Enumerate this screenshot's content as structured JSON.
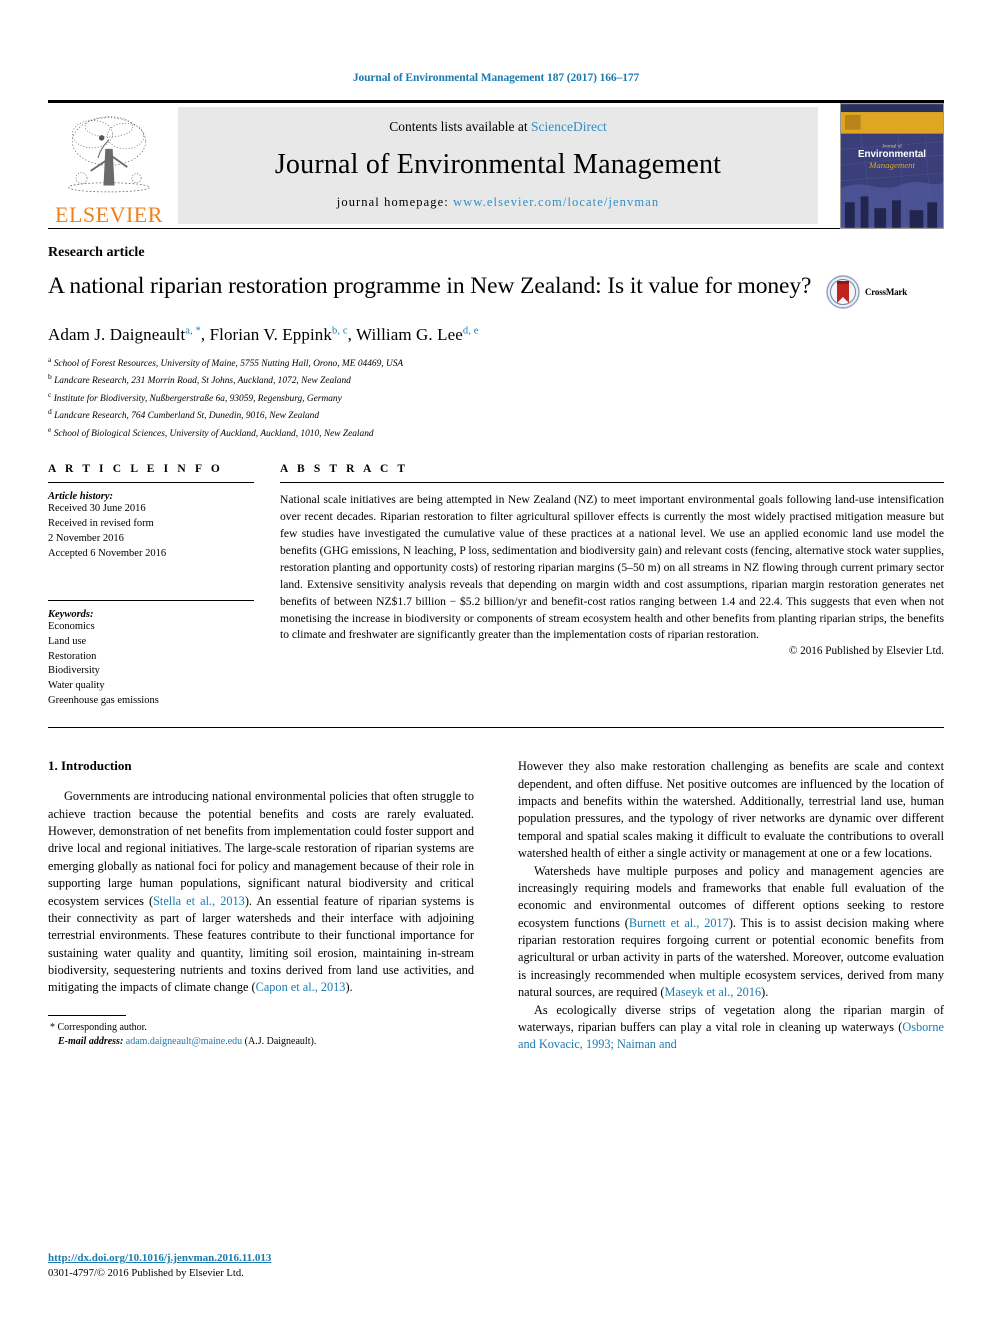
{
  "running_head": "Journal of Environmental Management 187 (2017) 166–177",
  "masthead": {
    "publisher_name": "ELSEVIER",
    "contents_prefix": "Contents lists available at ",
    "contents_link": "ScienceDirect",
    "journal_title": "Journal of Environmental Management",
    "homepage_prefix": "journal homepage: ",
    "homepage_url": "www.elsevier.com/locate/jenvman",
    "cover_title_line1": "Journal of",
    "cover_title_line2": "Environmental",
    "cover_title_line3": "Management"
  },
  "article": {
    "type": "Research article",
    "title": "A national riparian restoration programme in New Zealand: Is it value for money?",
    "crossmark_label": "CrossMark",
    "authors": [
      {
        "name": "Adam J. Daigneault",
        "marks": "a, *"
      },
      {
        "name": "Florian V. Eppink",
        "marks": "b, c"
      },
      {
        "name": "William G. Lee",
        "marks": "d, e"
      }
    ],
    "affiliations": [
      {
        "marker": "a",
        "text": "School of Forest Resources, University of Maine, 5755 Nutting Hall, Orono, ME 04469, USA"
      },
      {
        "marker": "b",
        "text": "Landcare Research, 231 Morrin Road, St Johns, Auckland, 1072, New Zealand"
      },
      {
        "marker": "c",
        "text": "Institute for Biodiversity, Nußbergerstraße 6a, 93059, Regensburg, Germany"
      },
      {
        "marker": "d",
        "text": "Landcare Research, 764 Cumberland St, Dunedin, 9016, New Zealand"
      },
      {
        "marker": "e",
        "text": "School of Biological Sciences, University of Auckland, Auckland, 1010, New Zealand"
      }
    ]
  },
  "article_info": {
    "heading": "A R T I C L E  I N F O",
    "history_label": "Article history:",
    "history": [
      "Received 30 June 2016",
      "Received in revised form",
      "2 November 2016",
      "Accepted 6 November 2016"
    ],
    "keywords_label": "Keywords:",
    "keywords": [
      "Economics",
      "Land use",
      "Restoration",
      "Biodiversity",
      "Water quality",
      "Greenhouse gas emissions"
    ]
  },
  "abstract": {
    "heading": "A B S T R A C T",
    "text": "National scale initiatives are being attempted in New Zealand (NZ) to meet important environmental goals following land-use intensification over recent decades. Riparian restoration to filter agricultural spillover effects is currently the most widely practised mitigation measure but few studies have investigated the cumulative value of these practices at a national level. We use an applied economic land use model the benefits (GHG emissions, N leaching, P loss, sedimentation and biodiversity gain) and relevant costs (fencing, alternative stock water supplies, restoration planting and opportunity costs) of restoring riparian margins (5–50 m) on all streams in NZ flowing through current primary sector land. Extensive sensitivity analysis reveals that depending on margin width and cost assumptions, riparian margin restoration generates net benefits of between NZ$1.7 billion − $5.2 billion/yr and benefit-cost ratios ranging between 1.4 and 22.4. This suggests that even when not monetising the increase in biodiversity or components of stream ecosystem health and other benefits from planting riparian strips, the benefits to climate and freshwater are significantly greater than the implementation costs of riparian restoration.",
    "copyright": "© 2016 Published by Elsevier Ltd."
  },
  "body": {
    "section_heading": "1. Introduction",
    "left_paragraphs": [
      {
        "segments": [
          {
            "t": "Governments are introducing national environmental policies that often struggle to achieve traction because the potential benefits and costs are rarely evaluated. However, demonstration of net benefits from implementation could foster support and drive local and regional initiatives. The large-scale restoration of riparian systems are emerging globally as national foci for policy and management because of their role in supporting large human populations, significant natural biodiversity and critical ecosystem services (",
            "link": false
          },
          {
            "t": "Stella et al., 2013",
            "link": true
          },
          {
            "t": "). An essential feature of riparian systems is their connectivity as part of larger watersheds and their interface with adjoining terrestrial environments. These features contribute to their functional importance for sustaining water quality and quantity, limiting soil erosion, maintaining in-stream biodiversity, sequestering nutrients and toxins derived from land use activities, and mitigating the impacts of climate change (",
            "link": false
          },
          {
            "t": "Capon et al., 2013",
            "link": true
          },
          {
            "t": ").",
            "link": false
          }
        ]
      }
    ],
    "right_paragraphs": [
      {
        "segments": [
          {
            "t": "However they also make restoration challenging as benefits are scale and context dependent, and often diffuse. Net positive outcomes are influenced by the location of impacts and benefits within the watershed. Additionally, terrestrial land use, human population pressures, and the typology of river networks are dynamic over different temporal and spatial scales making it difficult to evaluate the contributions to overall watershed health of either a single activity or management at one or a few locations.",
            "link": false
          }
        ],
        "indent": false
      },
      {
        "segments": [
          {
            "t": "Watersheds have multiple purposes and policy and management agencies are increasingly requiring models and frameworks that enable full evaluation of the economic and environmental outcomes of different options seeking to restore ecosystem functions (",
            "link": false
          },
          {
            "t": "Burnett et al., 2017",
            "link": true
          },
          {
            "t": "). This is to assist decision making where riparian restoration requires forgoing current or potential economic benefits from agricultural or urban activity in parts of the watershed. Moreover, outcome evaluation is increasingly recommended when multiple ecosystem services, derived from many natural sources, are required (",
            "link": false
          },
          {
            "t": "Maseyk et al., 2016",
            "link": true
          },
          {
            "t": ").",
            "link": false
          }
        ],
        "indent": true
      },
      {
        "segments": [
          {
            "t": "As ecologically diverse strips of vegetation along the riparian margin of waterways, riparian buffers can play a vital role in cleaning up waterways (",
            "link": false
          },
          {
            "t": "Osborne and Kovacic, 1993; Naiman and",
            "link": true
          }
        ],
        "indent": true
      }
    ]
  },
  "footnotes": {
    "corresponding_marker": "*",
    "corresponding_text": "Corresponding author.",
    "email_label": "E-mail address:",
    "email": "adam.daigneault@maine.edu",
    "email_suffix": "(A.J. Daigneault)."
  },
  "footer": {
    "doi": "http://dx.doi.org/10.1016/j.jenvman.2016.11.013",
    "issn_line": "0301-4797/© 2016 Published by Elsevier Ltd."
  },
  "colors": {
    "link": "#1a7bb0",
    "elsevier_orange": "#f08019",
    "sciencedirect_blue": "#2f8fc4",
    "banner_gray": "#e8e8e8",
    "cover_gold": "#e0a521",
    "cover_blue": "#3a3f7a"
  }
}
